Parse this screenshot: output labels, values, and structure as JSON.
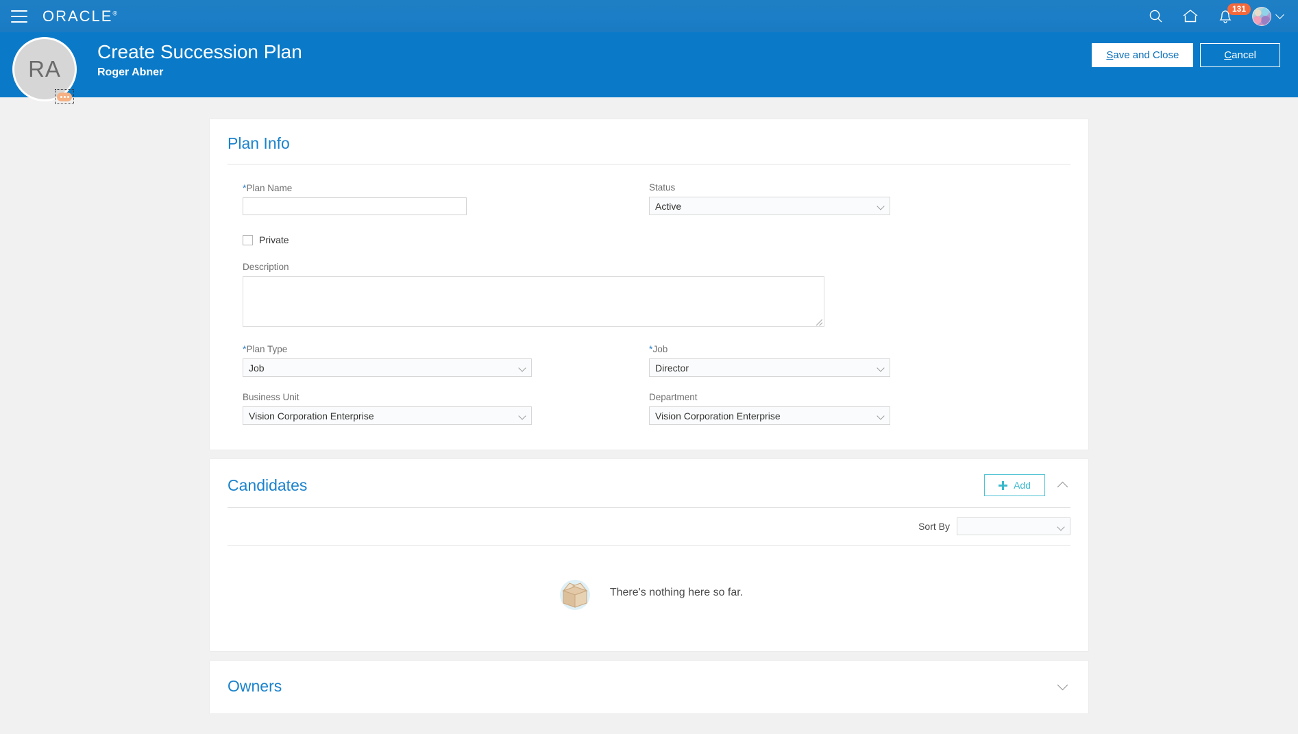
{
  "global_header": {
    "menu_icon": "hamburger-menu-icon",
    "brand": "ORACLE",
    "brand_mark": "®",
    "icons": [
      {
        "name": "search-icon"
      },
      {
        "name": "home-icon"
      },
      {
        "name": "notifications-bell-icon",
        "badge": "131"
      },
      {
        "name": "user-avatar"
      }
    ],
    "badge_color": "#f4693c",
    "bar_color": "#1b7ec6"
  },
  "page_header": {
    "title": "Create Succession Plan",
    "subtitle": "Roger Abner",
    "avatar_initials": "RA",
    "avatar_action": "more-actions-badge",
    "bg_color": "#0a7ac8",
    "save_label": "Save and Close",
    "save_accesskey": "S",
    "save_rest": "ave and Close",
    "cancel_label": "Cancel",
    "cancel_accesskey": "C",
    "cancel_rest": "ancel"
  },
  "plan_info": {
    "title": "Plan Info",
    "plan_name": {
      "label": "Plan Name",
      "required": true,
      "value": "",
      "placeholder": ""
    },
    "status": {
      "label": "Status",
      "required": false,
      "value": "Active"
    },
    "private": {
      "label": "Private",
      "checked": false
    },
    "description": {
      "label": "Description",
      "value": "",
      "placeholder": ""
    },
    "plan_type": {
      "label": "Plan Type",
      "required": true,
      "value": "Job"
    },
    "job": {
      "label": "Job",
      "required": true,
      "value": "Director"
    },
    "business_unit": {
      "label": "Business Unit",
      "required": false,
      "value": "Vision Corporation Enterprise"
    },
    "department": {
      "label": "Department",
      "required": false,
      "value": "Vision Corporation Enterprise"
    }
  },
  "candidates": {
    "title": "Candidates",
    "add_label": "Add",
    "collapse_icon": "chevron-up-icon",
    "sort_by_label": "Sort By",
    "sort_by_value": "",
    "empty_message": "There's nothing here so far.",
    "empty_illustration": "empty-box-illustration"
  },
  "owners": {
    "title": "Owners",
    "expand_icon": "chevron-down-icon"
  },
  "theme": {
    "link_blue": "#1a82cc",
    "accent_teal": "#3ab9cc",
    "page_bg": "#f1f1f1"
  }
}
